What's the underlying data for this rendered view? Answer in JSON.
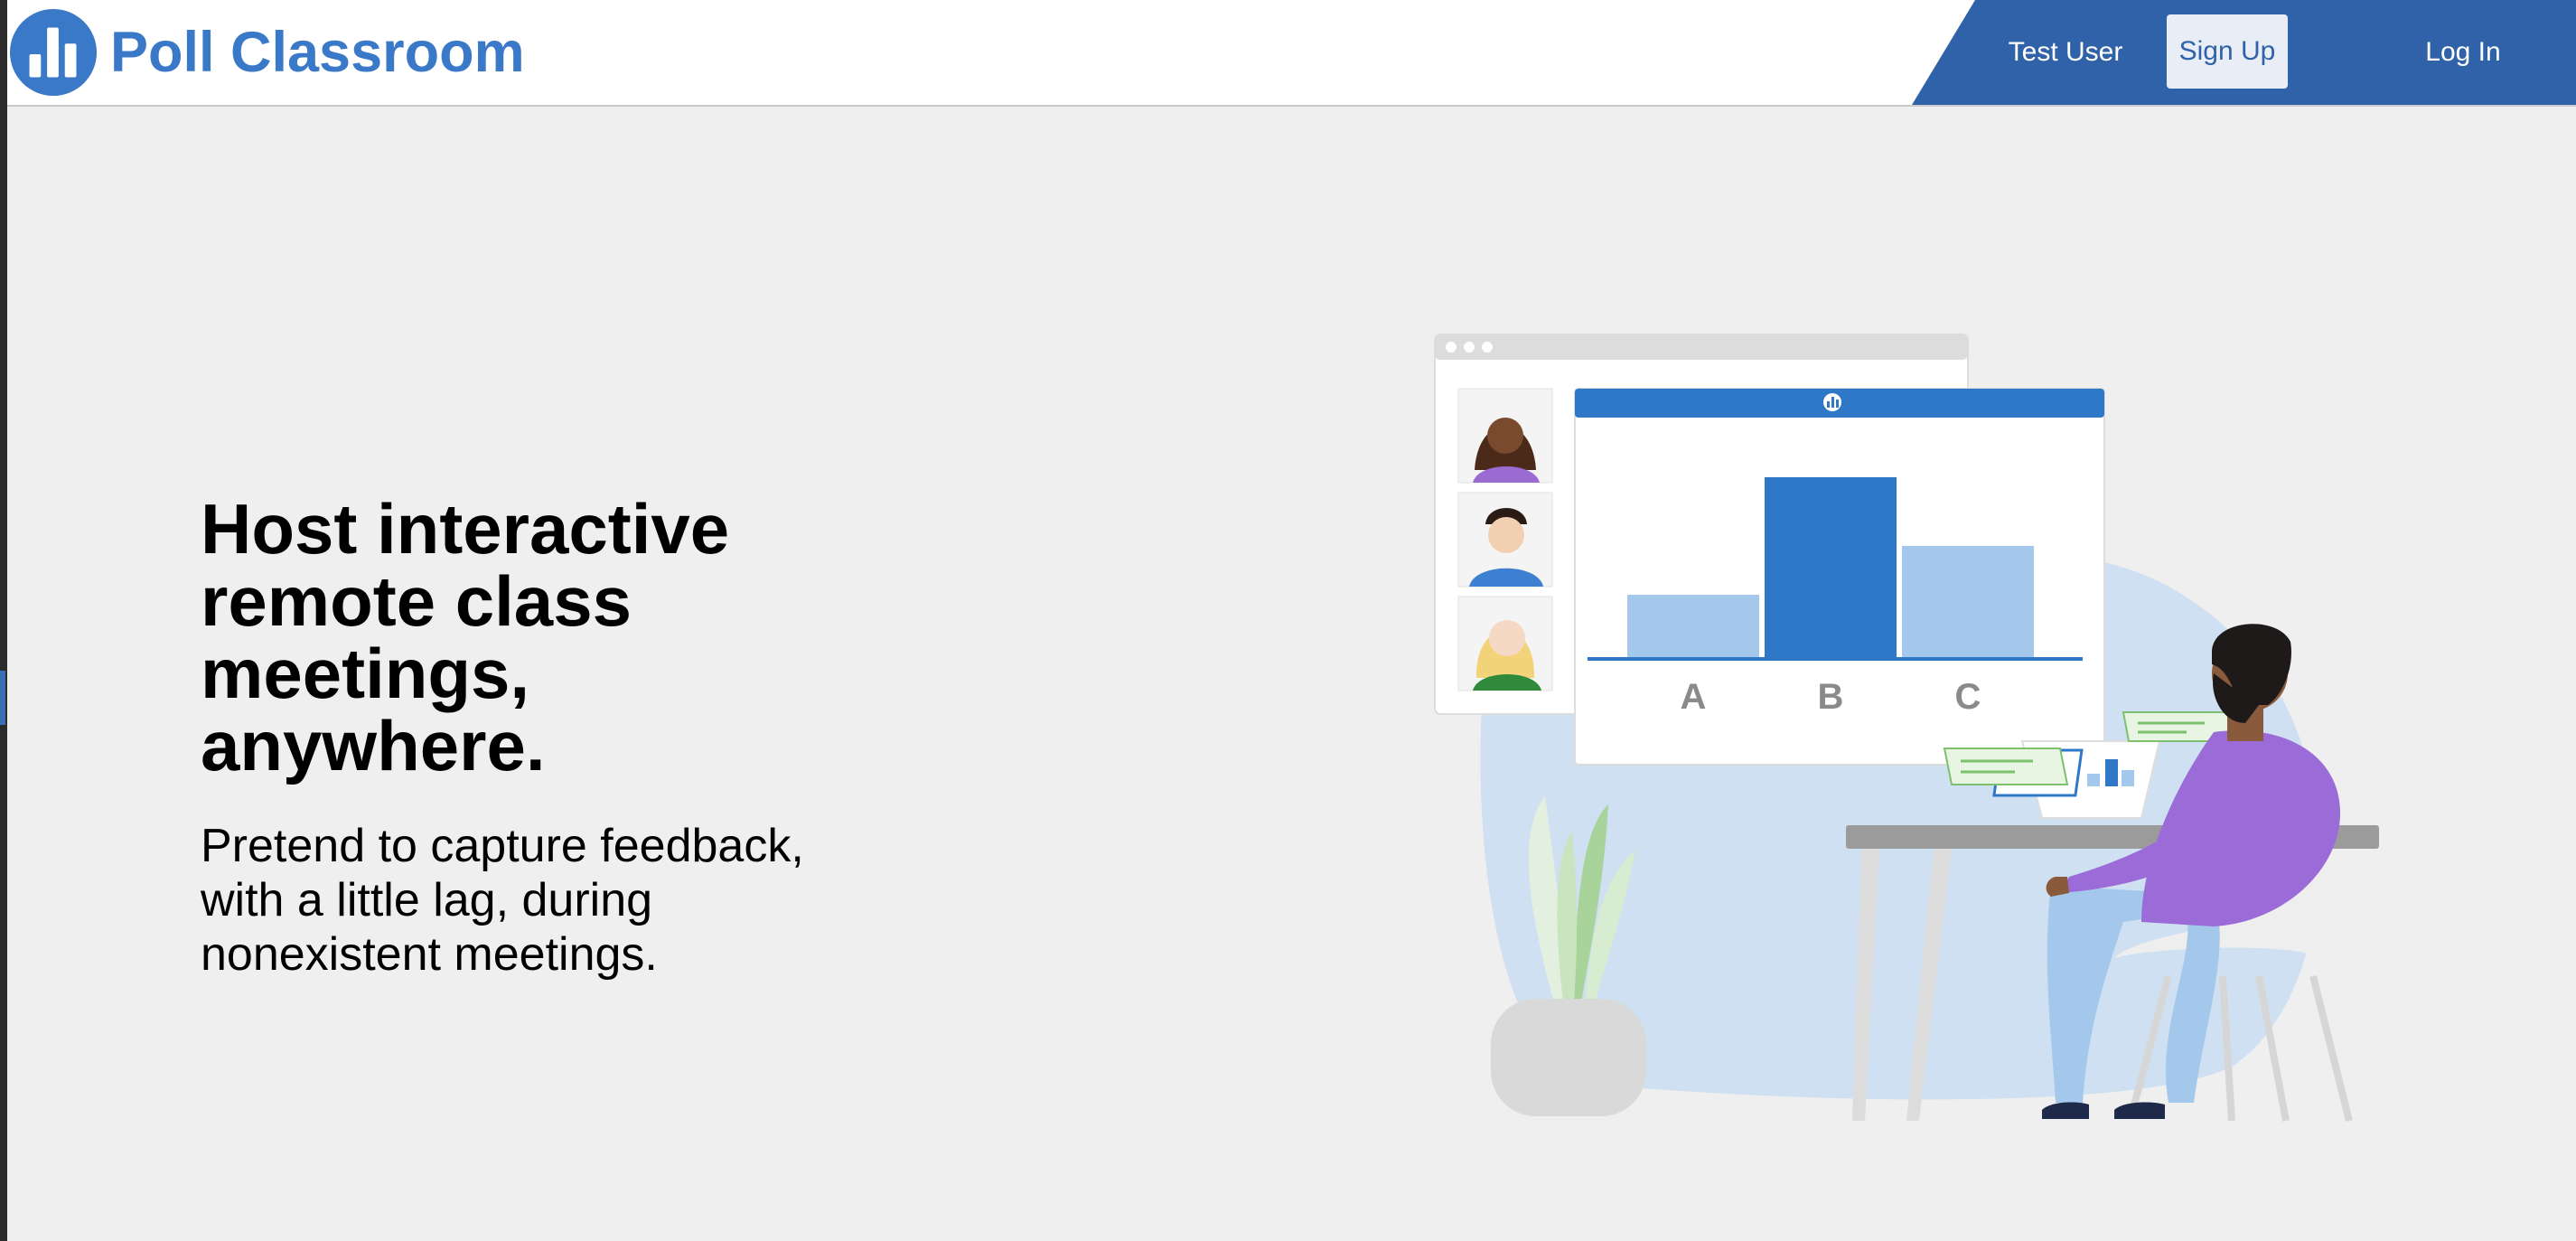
{
  "brand": {
    "name": "Poll Classroom",
    "logo_icon": "bar-chart-logo-icon"
  },
  "nav": {
    "test_user": "Test User",
    "sign_up": "Sign Up",
    "log_in": "Log In"
  },
  "hero": {
    "title_lines": [
      "Host interactive",
      "remote class",
      "meetings,",
      "anywhere."
    ],
    "subtitle_lines": [
      "Pretend to capture feedback,",
      "with a little lag, during",
      "nonexistent meetings."
    ]
  },
  "illustration": {
    "poll_header_icon": "bar-chart-logo-icon",
    "participants": [
      "participant-woman-dark-hair-icon",
      "participant-man-blue-shirt-icon",
      "participant-woman-blonde-icon"
    ]
  },
  "chart_data": {
    "type": "bar",
    "categories": [
      "A",
      "B",
      "C"
    ],
    "values": [
      35,
      100,
      62
    ],
    "highlight": "B",
    "colors": {
      "highlight": "#2f78c8",
      "default": "#a4c8eb"
    }
  },
  "colors": {
    "brand": "#3a78c8",
    "nav_bg": "#2f62a8",
    "page_bg": "#efefef"
  }
}
